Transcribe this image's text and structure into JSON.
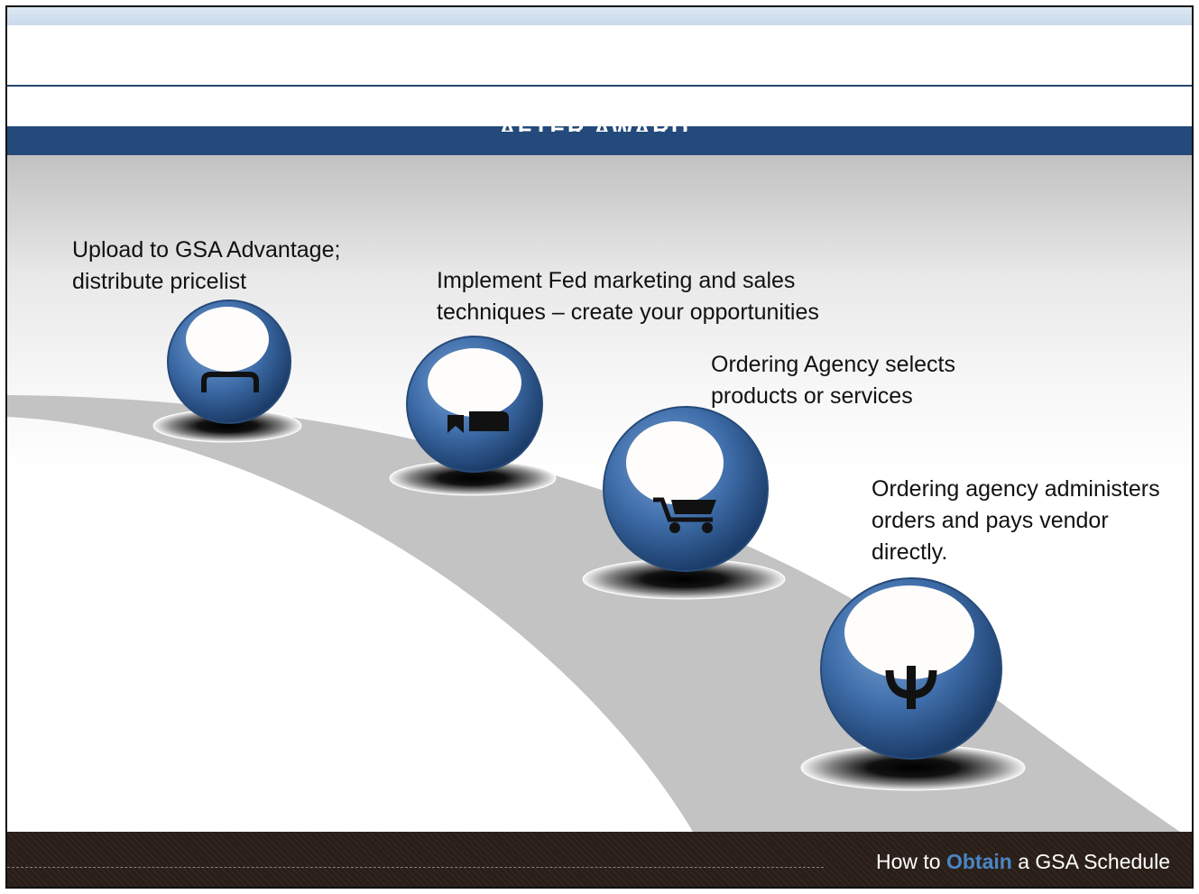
{
  "header": {
    "title": "AFTER AWARD"
  },
  "steps": [
    {
      "text_lines": [
        "Upload to GSA Advantage;",
        "distribute pricelist"
      ],
      "icon": "briefcase-icon"
    },
    {
      "text_lines": [
        "Implement Fed marketing and sales",
        "techniques – create your opportunities"
      ],
      "icon": "megaphone-icon"
    },
    {
      "text_lines": [
        "Ordering Agency selects",
        "products or services"
      ],
      "icon": "shopping-cart-icon"
    },
    {
      "text_lines": [
        "Ordering agency administers",
        "orders and pays vendor",
        "directly."
      ],
      "icon": "dollar-icon"
    }
  ],
  "footer": {
    "text_before": "How to ",
    "text_accent": "Obtain",
    "text_after": " a GSA Schedule"
  },
  "colors": {
    "title_bar": "#234a7b",
    "sphere": "#3f6eaa",
    "road": "#c3c3c3",
    "footer_bg": "#2a1f18",
    "footer_accent": "#4a86c6"
  }
}
